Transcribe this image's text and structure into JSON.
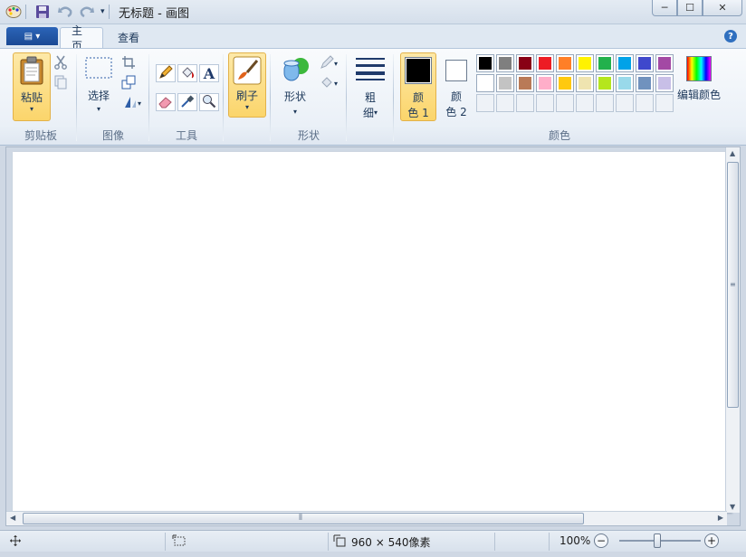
{
  "window": {
    "title": "无标题 - 画图",
    "min_label": "─",
    "max_label": "☐",
    "close_label": "✕"
  },
  "tabs": {
    "app_menu_label": "▤ ▾",
    "home": "主页",
    "view": "查看",
    "help": "?"
  },
  "ribbon": {
    "clipboard": {
      "paste": "粘贴",
      "label": "剪贴板"
    },
    "image": {
      "select": "选择",
      "label": "图像"
    },
    "tools": {
      "label": "工具"
    },
    "brush": {
      "label": "刷子"
    },
    "shapes": {
      "shapes": "形状",
      "label": "形状"
    },
    "size": {
      "line1": "粗",
      "line2": "细"
    },
    "colors": {
      "color1_line1": "颜",
      "color1_line2": "色 1",
      "color2_line1": "颜",
      "color2_line2": "色 2",
      "edit": "编辑颜色",
      "label": "颜色",
      "row1": [
        "#000000",
        "#7f7f7f",
        "#880015",
        "#ed1c24",
        "#ff7f27",
        "#fff200",
        "#22b14c",
        "#00a2e8",
        "#3f48cc",
        "#a349a4"
      ],
      "row2": [
        "#ffffff",
        "#c3c3c3",
        "#b97a57",
        "#ffaec9",
        "#ffc90e",
        "#efe4b0",
        "#b5e61d",
        "#99d9ea",
        "#7092be",
        "#c8bfe7"
      ],
      "color1": "#000000",
      "color2": "#ffffff"
    }
  },
  "status": {
    "size": "960 × 540像素",
    "zoom": "100%"
  }
}
